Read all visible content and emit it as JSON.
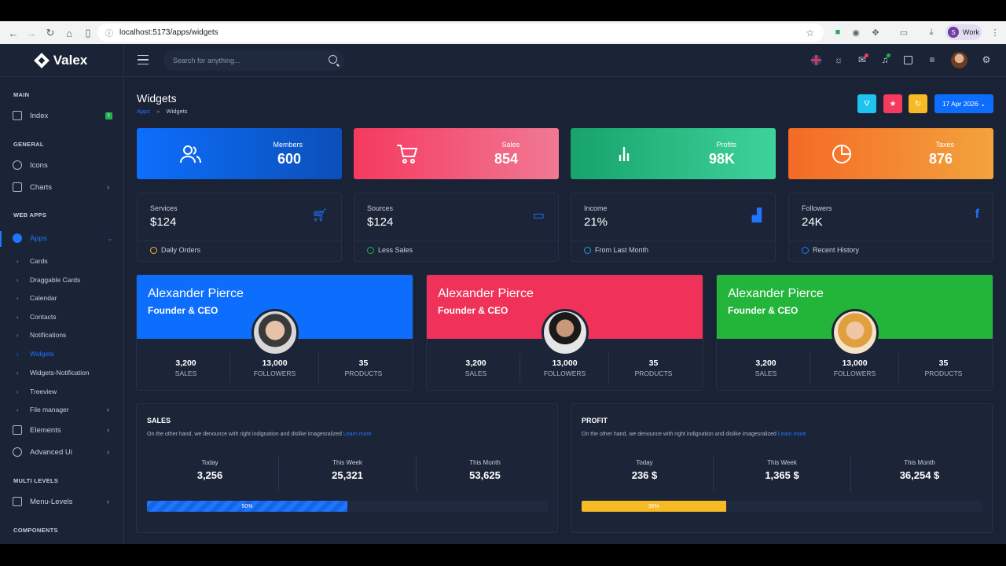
{
  "browser": {
    "url": "localhost:5173/apps/widgets",
    "profile_initial": "S",
    "profile_label": "Work"
  },
  "brand": {
    "name": "Valex"
  },
  "sidebar": {
    "cat_main": "MAIN",
    "cat_general": "GENERAL",
    "cat_webapps": "WEB APPS",
    "cat_multilevels": "MULTI LEVELS",
    "cat_components": "COMPONENTS",
    "index": "Index",
    "index_badge": "1",
    "icons": "Icons",
    "charts": "Charts",
    "apps": "Apps",
    "elements": "Elements",
    "advanced_ui": "Advanced Ui",
    "menu_levels": "Menu-Levels",
    "sub_items": [
      "Cards",
      "Draggable Cards",
      "Calendar",
      "Contacts",
      "Notifications",
      "Widgets",
      "Widgets-Notification",
      "Treeview",
      "File manager"
    ]
  },
  "header": {
    "search_placeholder": "Search for anything..."
  },
  "page": {
    "title": "Widgets",
    "crumb_parent": "Apps",
    "crumb_sep": "»",
    "crumb_current": "Widgets",
    "date_button": "17 Apr 2026 ⌄"
  },
  "stats": [
    {
      "label": "Members",
      "value": "600",
      "color1": "#0d6efd",
      "color2": "#0b4fb8",
      "icon": "users-icon"
    },
    {
      "label": "Sales",
      "value": "854",
      "color1": "#f5395f",
      "color2": "#f07994",
      "icon": "cart-icon"
    },
    {
      "label": "Profits",
      "value": "98K",
      "color1": "#17a36b",
      "color2": "#3ed39b",
      "icon": "bar-chart-icon"
    },
    {
      "label": "Taxes",
      "value": "876",
      "color1": "#f46a26",
      "color2": "#f3a33c",
      "icon": "pie-chart-icon"
    }
  ],
  "info_cards": [
    {
      "label": "Services",
      "value": "$124",
      "footer": "Daily Orders",
      "icon": "cart-icon",
      "foot_color": "#f7b924"
    },
    {
      "label": "Sources",
      "value": "$124",
      "footer": "Less Sales",
      "icon": "credit-card-icon",
      "foot_color": "#22b14c"
    },
    {
      "label": "Income",
      "value": "21%",
      "footer": "From Last Month",
      "icon": "bar-chart-icon",
      "foot_color": "#1f9bcf"
    },
    {
      "label": "Followers",
      "value": "24K",
      "footer": "Recent History",
      "icon": "facebook-icon",
      "foot_color": "#1f75ff"
    }
  ],
  "profiles": [
    {
      "name": "Alexander Pierce",
      "role": "Founder & CEO",
      "color": "#0d6efd",
      "sales": "3,200",
      "followers": "13,000",
      "products": "35"
    },
    {
      "name": "Alexander Pierce",
      "role": "Founder & CEO",
      "color": "#f0325a",
      "sales": "3,200",
      "followers": "13,000",
      "products": "35"
    },
    {
      "name": "Alexander Pierce",
      "role": "Founder & CEO",
      "color": "#22b53a",
      "sales": "3,200",
      "followers": "13,000",
      "products": "35"
    }
  ],
  "profile_labels": {
    "sales": "SALES",
    "followers": "FOLLOWERS",
    "products": "PRODUCTS"
  },
  "big_cards": [
    {
      "title": "SALES",
      "desc": "On the other hand, we denounce with right indignation and dislike imagesralized",
      "link": "Learn more",
      "today_label": "Today",
      "today": "3,256",
      "week_label": "This Week",
      "week": "25,321",
      "month_label": "This Month",
      "month": "53,625",
      "progress_label": "50%",
      "progress": 0.5
    },
    {
      "title": "PROFIT",
      "desc": "On the other hand, we denounce with right indignation and dislike imagesralized",
      "link": "Learn more",
      "today_label": "Today",
      "today": "236 $",
      "week_label": "This Week",
      "week": "1,365 $",
      "month_label": "This Month",
      "month": "36,254 $",
      "progress_label": "36%",
      "progress": 0.36
    }
  ]
}
